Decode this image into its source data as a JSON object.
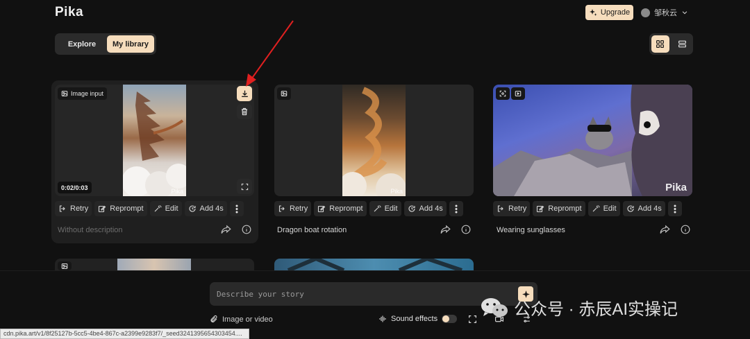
{
  "app": {
    "logo": "Pika"
  },
  "header": {
    "upgrade_label": "Upgrade",
    "username": "邹秋云"
  },
  "tabs": {
    "explore": "Explore",
    "my_library": "My library"
  },
  "actions": {
    "retry": "Retry",
    "reprompt": "Reprompt",
    "edit": "Edit",
    "add": "Add 4s"
  },
  "cards": [
    {
      "badge_label": "Image input",
      "duration": "0:02/0:03",
      "description": "Without description",
      "video_watermark": "Pika"
    },
    {
      "description": "Dragon boat rotation",
      "video_watermark": "Pika"
    },
    {
      "description": "Wearing sunglasses",
      "video_watermark": "Pika"
    }
  ],
  "prompt": {
    "placeholder": "Describe your story",
    "attach_label": "Image or video",
    "sound_label": "Sound effects"
  },
  "status_url": "cdn.pika.art/v1/8f25127b-5cc5-4be4-867c-a2399e9283f7/_seed3241395654303454....",
  "overlay_watermark": "公众号 · 赤辰AI实操记",
  "colors": {
    "accent": "#f6ddbd",
    "background": "#111111",
    "card": "#1f1f1f",
    "annotation_arrow": "#e02020"
  }
}
